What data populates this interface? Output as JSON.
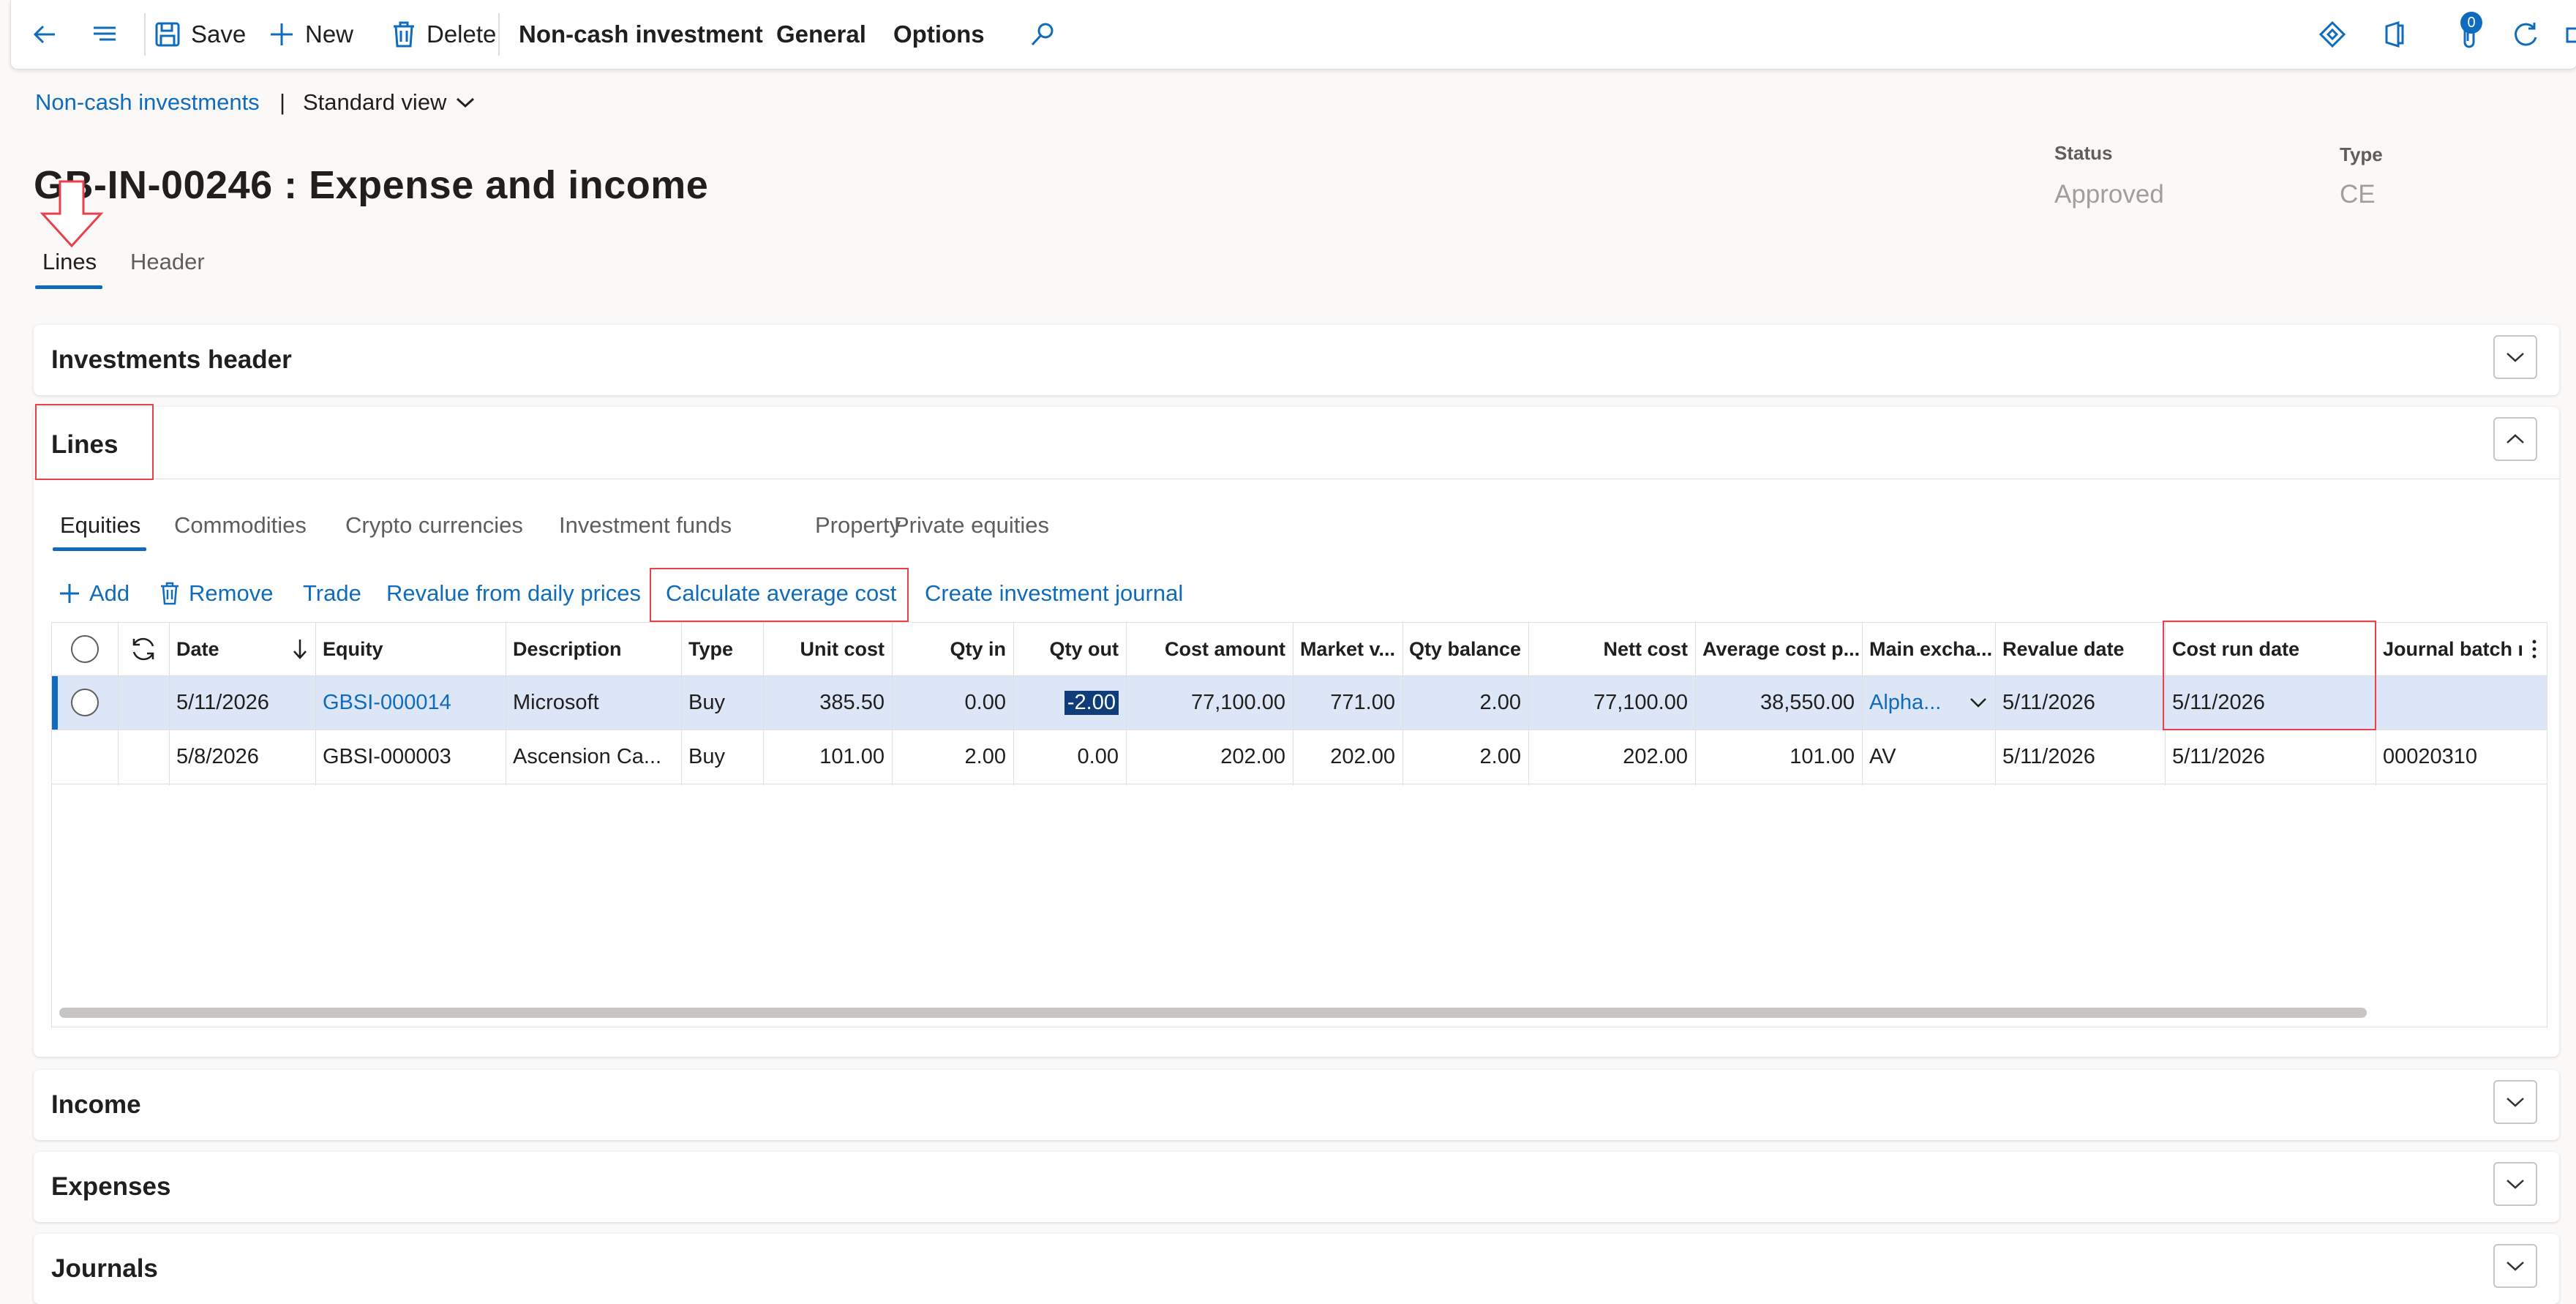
{
  "toolbar": {
    "save": "Save",
    "new": "New",
    "delete": "Delete",
    "menu1": "Non-cash investment",
    "menu2": "General",
    "menu3": "Options",
    "badge_count": "0"
  },
  "breadcrumb": {
    "link": "Non-cash investments",
    "separator": "|",
    "view": "Standard view"
  },
  "record": {
    "title": "GB-IN-00246 : Expense and income",
    "status_label": "Status",
    "status_value": "Approved",
    "type_label": "Type",
    "type_value": "CE"
  },
  "page_tabs": [
    "Lines",
    "Header"
  ],
  "sections": {
    "investments_header": "Investments header",
    "lines": "Lines",
    "income": "Income",
    "expenses": "Expenses",
    "journals": "Journals"
  },
  "line_tabs": [
    "Equities",
    "Commodities",
    "Crypto currencies",
    "Investment funds",
    "Property",
    "Private equities"
  ],
  "actions": {
    "add": "Add",
    "remove": "Remove",
    "trade": "Trade",
    "revalue": "Revalue from daily prices",
    "calc_avg": "Calculate average cost",
    "create_journal": "Create investment journal"
  },
  "grid": {
    "columns": [
      "Date",
      "Equity",
      "Description",
      "Type",
      "Unit cost",
      "Qty in",
      "Qty out",
      "Cost amount",
      "Market v...",
      "Qty balance",
      "Nett cost",
      "Average cost p...",
      "Main excha...",
      "Revalue date",
      "Cost run date",
      "Journal batch n"
    ],
    "rows": [
      [
        "5/11/2026",
        "GBSI-000014",
        "Microsoft",
        "Buy",
        "385.50",
        "0.00",
        "-2.00",
        "77,100.00",
        "771.00",
        "2.00",
        "77,100.00",
        "38,550.00",
        "Alpha...",
        "5/11/2026",
        "5/11/2026",
        ""
      ],
      [
        "5/8/2026",
        "GBSI-000003",
        "Ascension Ca...",
        "Buy",
        "101.00",
        "2.00",
        "0.00",
        "202.00",
        "202.00",
        "2.00",
        "202.00",
        "101.00",
        "AV",
        "5/11/2026",
        "5/11/2026",
        "00020310"
      ]
    ]
  },
  "colors": {
    "accent": "#0f6cbd",
    "highlight": "#e8414c",
    "selected_row": "#dce6f7"
  }
}
